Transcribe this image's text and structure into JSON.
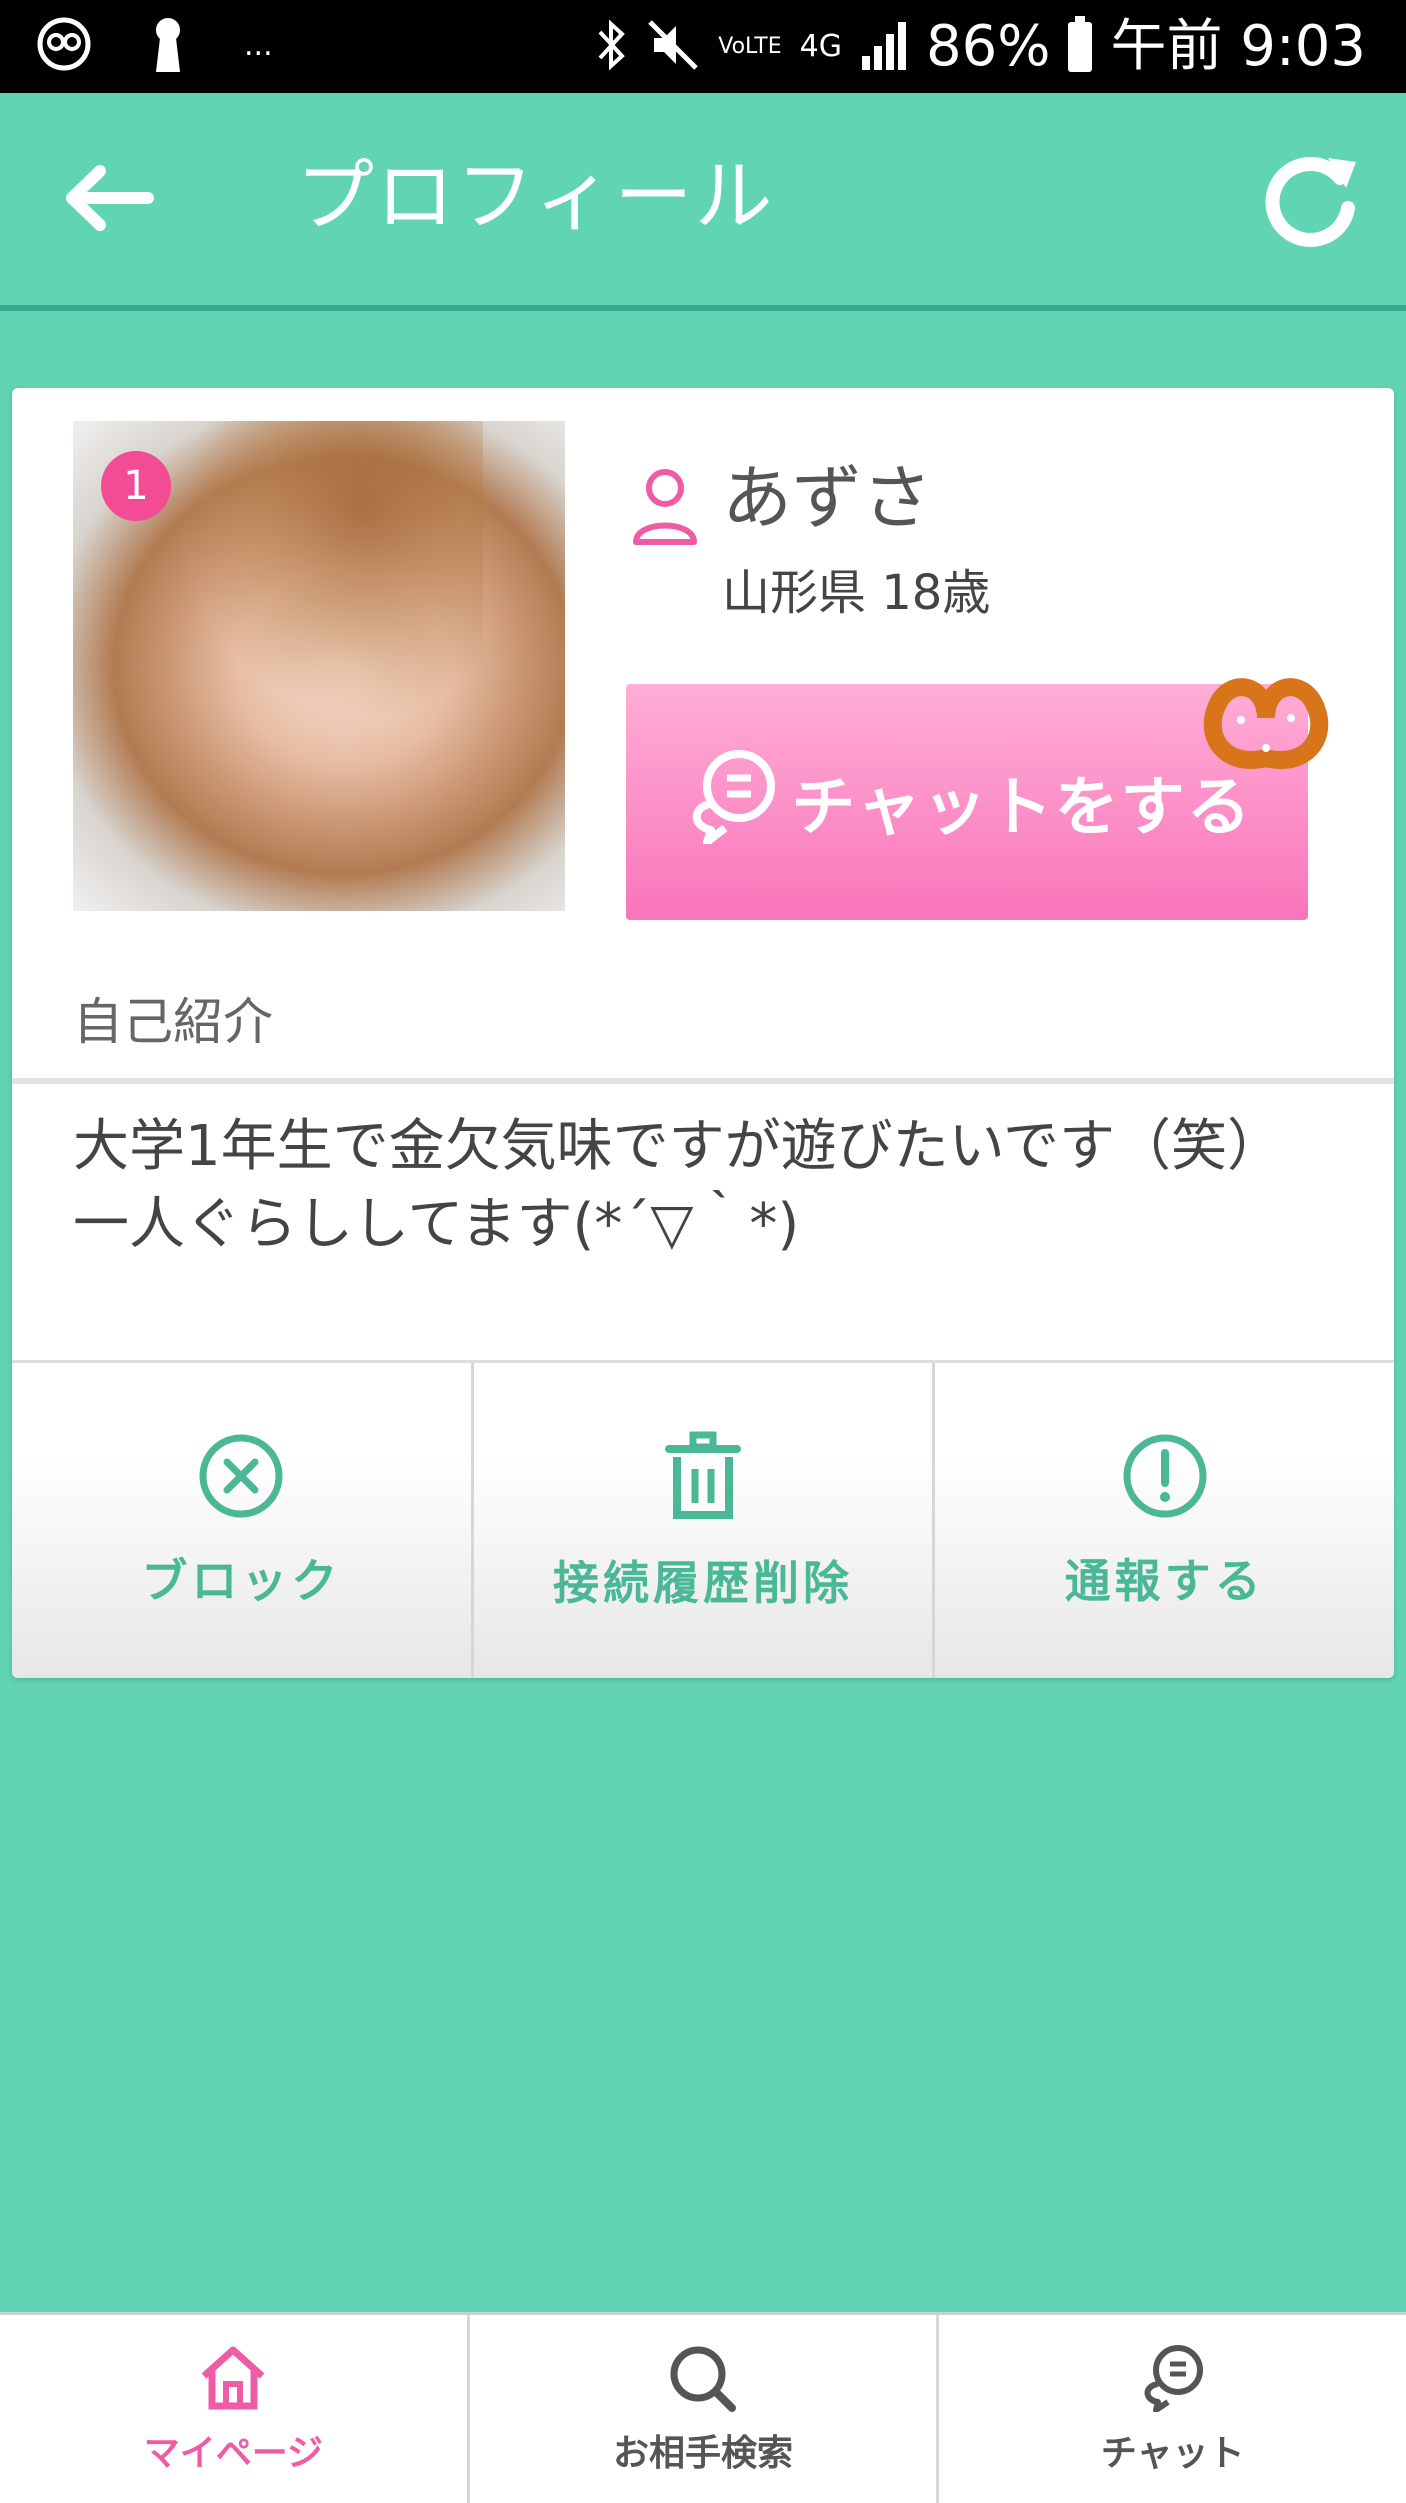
{
  "status_bar": {
    "battery": "86%",
    "time": "午前 9:03",
    "network": "4G",
    "volte": "VoLTE",
    "dots": "..."
  },
  "header": {
    "title": "プロフィール",
    "icons": {
      "back": "back-arrow-icon",
      "refresh": "refresh-icon"
    }
  },
  "profile": {
    "photo_badge": "1",
    "name": "あずさ",
    "info": "山形県 18歳",
    "chat_button": "チャットをする",
    "intro_label": "自己紹介",
    "intro_text": "大学1年生で金欠気味ですが遊びたいです（笑）一人ぐらししてます(*´▽｀*)"
  },
  "actions": [
    {
      "label": "ブロック",
      "icon": "block-x-icon"
    },
    {
      "label": "接続履歴削除",
      "icon": "trash-icon"
    },
    {
      "label": "通報する",
      "icon": "alert-icon"
    }
  ],
  "bottom_nav": [
    {
      "label": "マイページ",
      "icon": "home-icon",
      "active": true
    },
    {
      "label": "お相手検索",
      "icon": "search-icon",
      "active": false
    },
    {
      "label": "チャット",
      "icon": "chat-bubble-icon",
      "active": false
    }
  ],
  "colors": {
    "primary": "#61d4b3",
    "accent_pink": "#f05ba5",
    "action_green": "#4ab896"
  }
}
